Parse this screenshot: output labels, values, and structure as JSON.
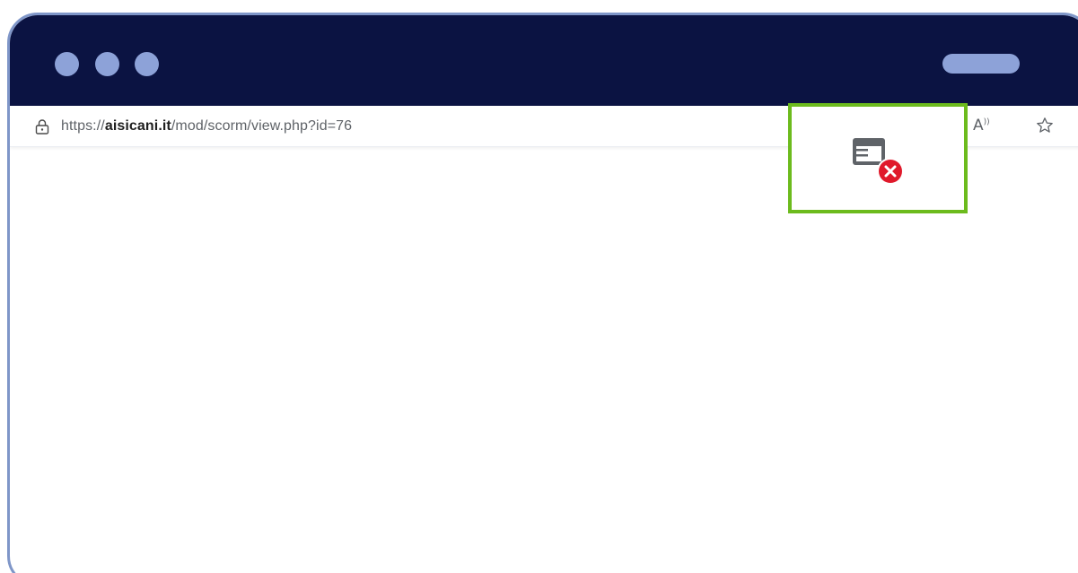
{
  "window": {
    "controls": [
      "window-dot",
      "window-dot",
      "window-dot"
    ],
    "accent_color": "#8da2d8",
    "title_bar_color": "#0b1342"
  },
  "address_bar": {
    "url_prefix": "https://",
    "url_domain": "aisicani.it",
    "url_path": "/mod/scorm/view.php?id=76",
    "icons": [
      "lock-icon",
      "read-aloud-icon",
      "favorite-icon"
    ]
  },
  "highlight": {
    "icon": "blocked-popup-icon",
    "border_color": "#6cbb1d",
    "badge_color": "#e0192b"
  }
}
